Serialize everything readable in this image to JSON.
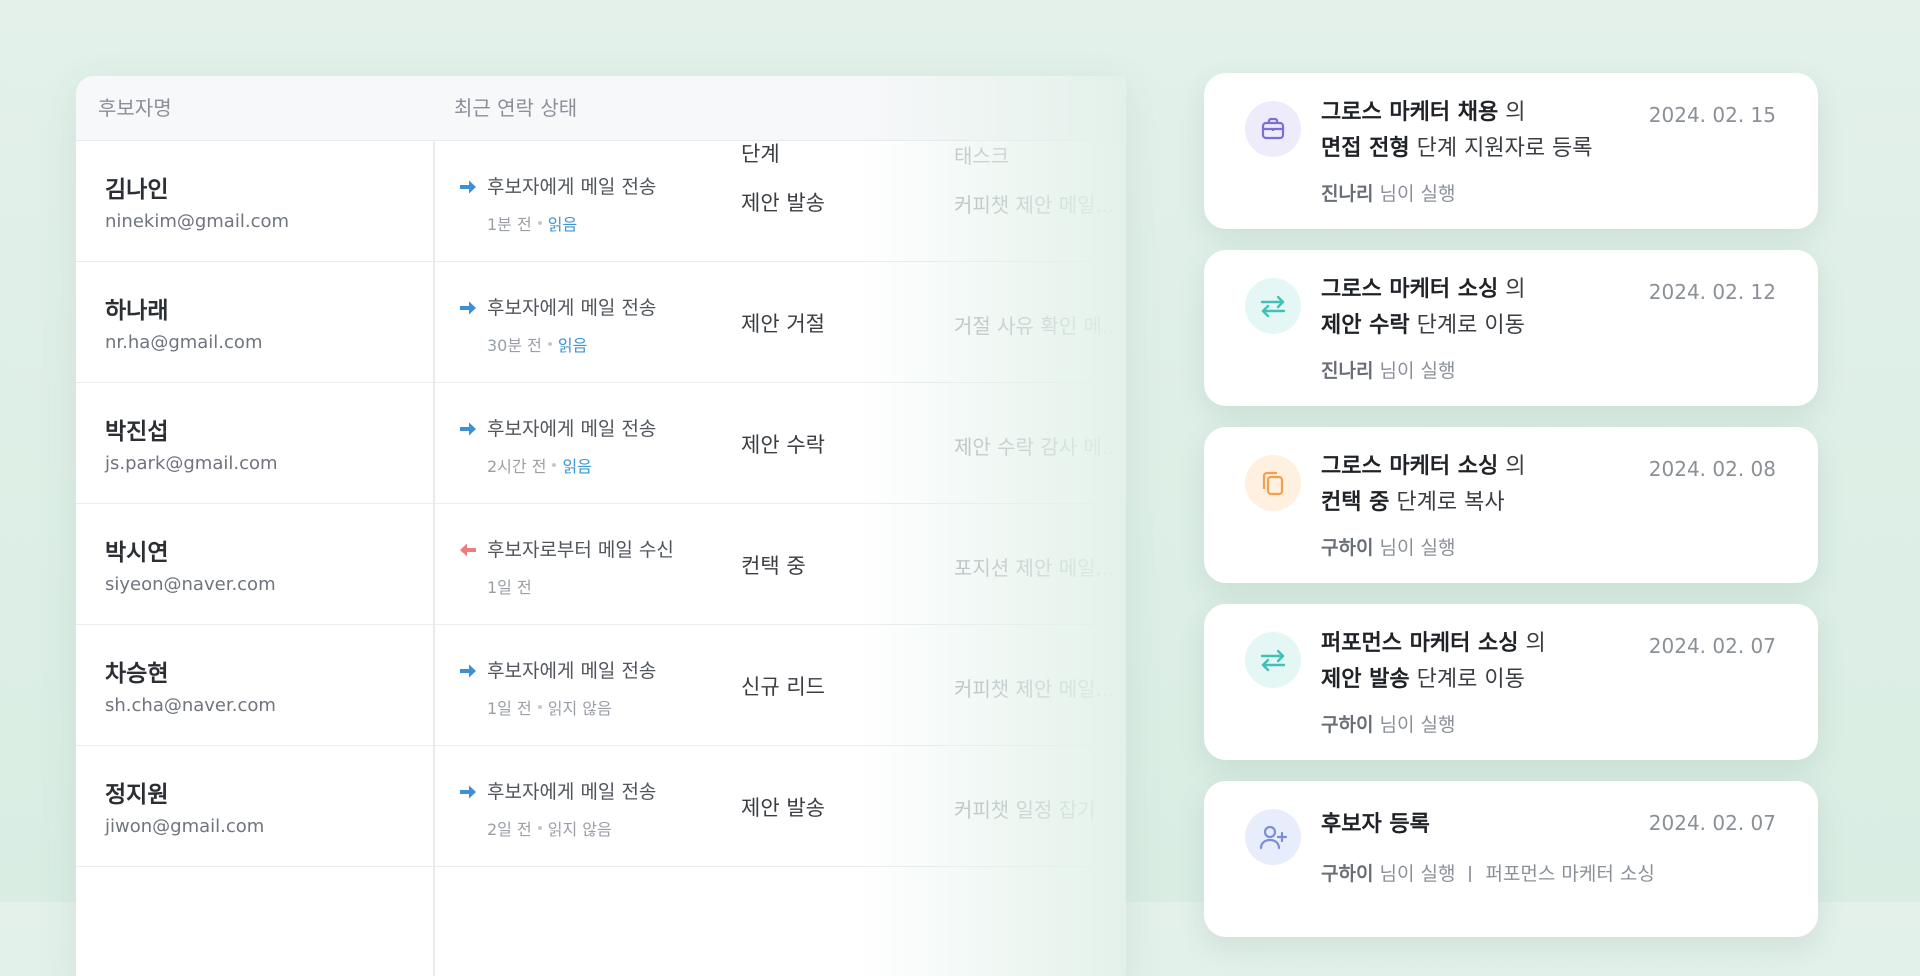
{
  "table": {
    "headers": {
      "name": "후보자명",
      "status": "최근 연락 상태",
      "stage": "단계",
      "task": "태스크"
    },
    "rows": [
      {
        "name": "김나인",
        "email": "ninekim@gmail.com",
        "status": "후보자에게 메일 전송",
        "direction": "outgoing",
        "time": "1분 전",
        "read_state": "읽음",
        "stage": "제안 발송",
        "task": "커피챗 제안 메일..."
      },
      {
        "name": "하나래",
        "email": "nr.ha@gmail.com",
        "status": "후보자에게 메일 전송",
        "direction": "outgoing",
        "time": "30분 전",
        "read_state": "읽음",
        "stage": "제안 거절",
        "task": "거절 사유 확인 메..."
      },
      {
        "name": "박진섭",
        "email": "js.park@gmail.com",
        "status": "후보자에게 메일 전송",
        "direction": "outgoing",
        "time": "2시간 전",
        "read_state": "읽음",
        "stage": "제안 수락",
        "task": "제안 수락 감사 메..."
      },
      {
        "name": "박시연",
        "email": "siyeon@naver.com",
        "status": "후보자로부터 메일 수신",
        "direction": "incoming",
        "time": "1일 전",
        "read_state": "",
        "stage": "컨택 중",
        "task": "포지션 제안 메일..."
      },
      {
        "name": "차승현",
        "email": "sh.cha@naver.com",
        "status": "후보자에게 메일 전송",
        "direction": "outgoing",
        "time": "1일 전",
        "read_state": "읽지 않음",
        "stage": "신규 리드",
        "task": "커피챗 제안 메일..."
      },
      {
        "name": "정지원",
        "email": "jiwon@gmail.com",
        "status": "후보자에게 메일 전송",
        "direction": "outgoing",
        "time": "2일 전",
        "read_state": "읽지 않음",
        "stage": "제안 발송",
        "task": "커피챗 일정 잡기"
      }
    ]
  },
  "activity": [
    {
      "icon": "briefcase-icon",
      "icon_color": "#7b6fd6",
      "icon_bg": "#eeebfb",
      "title_bold": "그로스 마케터 채용",
      "title_mid": "의",
      "line2_bold": "면접 전형",
      "line2_rest": "단계 지원자로 등록",
      "date": "2024. 02. 15",
      "actor": "진나리",
      "actor_suffix": "님이 실행",
      "extra": ""
    },
    {
      "icon": "swap-arrows-icon",
      "icon_color": "#3fc1ba",
      "icon_bg": "#e4f7f5",
      "title_bold": "그로스 마케터 소싱",
      "title_mid": "의",
      "line2_bold": "제안 수락",
      "line2_rest": "단계로 이동",
      "date": "2024. 02. 12",
      "actor": "진나리",
      "actor_suffix": "님이 실행",
      "extra": ""
    },
    {
      "icon": "copy-icon",
      "icon_color": "#f2a04d",
      "icon_bg": "#fff0df",
      "title_bold": "그로스 마케터 소싱",
      "title_mid": "의",
      "line2_bold": "컨택 중",
      "line2_rest": "단계로 복사",
      "date": "2024. 02. 08",
      "actor": "구하이",
      "actor_suffix": "님이 실행",
      "extra": ""
    },
    {
      "icon": "swap-arrows-icon",
      "icon_color": "#3fc1ba",
      "icon_bg": "#e4f7f5",
      "title_bold": "퍼포먼스 마케터 소싱",
      "title_mid": "의",
      "line2_bold": "제안 발송",
      "line2_rest": "단계로 이동",
      "date": "2024. 02. 07",
      "actor": "구하이",
      "actor_suffix": "님이 실행",
      "extra": ""
    },
    {
      "icon": "user-add-icon",
      "icon_color": "#7a8fd8",
      "icon_bg": "#e8edfb",
      "title_bold": "후보자 등록",
      "title_mid": "",
      "line2_bold": "",
      "line2_rest": "",
      "date": "2024. 02. 07",
      "actor": "구하이",
      "actor_suffix": "님이 실행",
      "extra": "퍼포먼스 마케터 소싱"
    }
  ]
}
